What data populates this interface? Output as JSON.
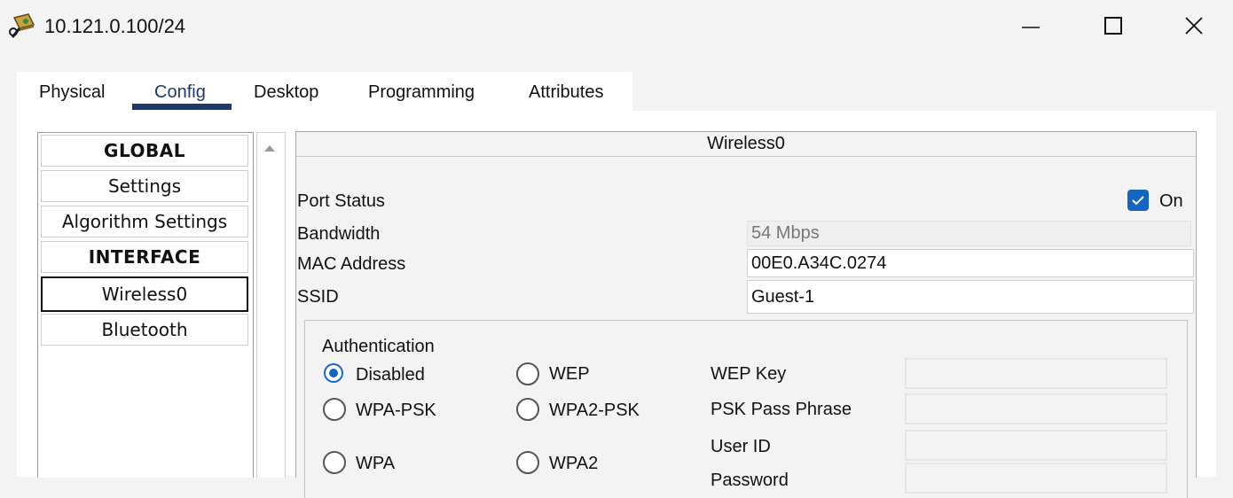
{
  "window": {
    "title": "10.121.0.100/24",
    "icon": "router-network-icon"
  },
  "tabs": [
    {
      "label": "Physical"
    },
    {
      "label": "Config",
      "selected": true
    },
    {
      "label": "Desktop"
    },
    {
      "label": "Programming"
    },
    {
      "label": "Attributes"
    }
  ],
  "sidebar": {
    "items": [
      {
        "label": "GLOBAL",
        "type": "header"
      },
      {
        "label": "Settings"
      },
      {
        "label": "Algorithm Settings"
      },
      {
        "label": "INTERFACE",
        "type": "header"
      },
      {
        "label": "Wireless0",
        "selected": true
      },
      {
        "label": "Bluetooth"
      }
    ]
  },
  "interface": {
    "title": "Wireless0",
    "port_status": {
      "label": "Port Status",
      "checkbox_label": "On",
      "checked": true
    },
    "bandwidth": {
      "label": "Bandwidth",
      "value": "54 Mbps"
    },
    "mac_address": {
      "label": "MAC Address",
      "value": "00E0.A34C.0274"
    },
    "ssid": {
      "label": "SSID",
      "value": "Guest-1"
    }
  },
  "authentication": {
    "title": "Authentication",
    "options": {
      "disabled": {
        "label": "Disabled",
        "selected": true
      },
      "wep": {
        "label": "WEP"
      },
      "wpa_psk": {
        "label": "WPA-PSK"
      },
      "wpa2_psk": {
        "label": "WPA2-PSK"
      },
      "wpa": {
        "label": "WPA"
      },
      "wpa2": {
        "label": "WPA2"
      }
    },
    "fields": {
      "wep_key": {
        "label": "WEP Key",
        "value": ""
      },
      "psk_pass_phrase": {
        "label": "PSK Pass Phrase",
        "value": ""
      },
      "user_id": {
        "label": "User ID",
        "value": ""
      },
      "password": {
        "label": "Password",
        "value": ""
      }
    }
  },
  "colors": {
    "accent": "#1565c0",
    "tab_underline": "#1e3a6b",
    "background": "#f3f3f3"
  }
}
